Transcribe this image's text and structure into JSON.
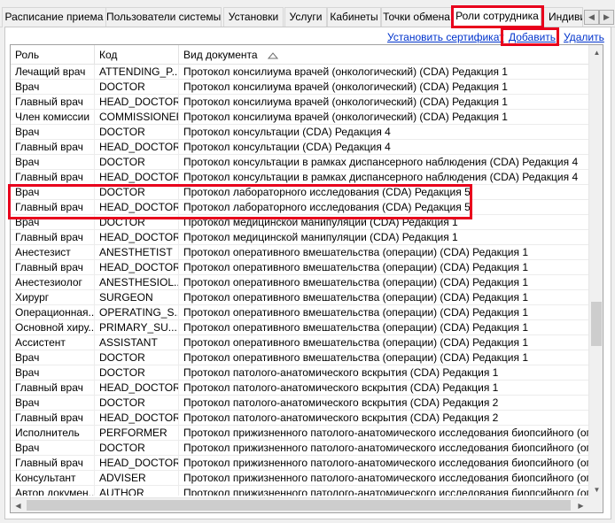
{
  "tabs": [
    {
      "label": "Расписание приема"
    },
    {
      "label": "Пользователи системы"
    },
    {
      "label": "Установки"
    },
    {
      "label": "Услуги"
    },
    {
      "label": "Кабинеты"
    },
    {
      "label": "Точки обмена"
    },
    {
      "label": "Роли сотрудника"
    },
    {
      "label": "Индивид"
    }
  ],
  "actions": {
    "install_cert": "Установить сертификат",
    "add": "Добавить",
    "delete": "Удалить"
  },
  "table": {
    "columns": [
      "Роль",
      "Код",
      "Вид документа"
    ],
    "sorted_column": "Вид документа",
    "sort_direction": "ascending",
    "rows": [
      [
        "Лечащий врач",
        "ATTENDING_P...",
        "Протокол консилиума врачей (онкологический) (CDA) Редакция 1"
      ],
      [
        "Врач",
        "DOCTOR",
        "Протокол консилиума врачей (онкологический) (CDA) Редакция 1"
      ],
      [
        "Главный врач",
        "HEAD_DOCTOR",
        "Протокол консилиума врачей (онкологический) (CDA) Редакция 1"
      ],
      [
        "Член комиссии",
        "COMMISSIONER",
        "Протокол консилиума врачей (онкологический) (CDA) Редакция 1"
      ],
      [
        "Врач",
        "DOCTOR",
        "Протокол консультации (CDA) Редакция 4"
      ],
      [
        "Главный врач",
        "HEAD_DOCTOR",
        "Протокол консультации (CDA) Редакция 4"
      ],
      [
        "Врач",
        "DOCTOR",
        "Протокол консультации в рамках диспансерного наблюдения (CDA) Редакция 4"
      ],
      [
        "Главный врач",
        "HEAD_DOCTOR",
        "Протокол консультации в рамках диспансерного наблюдения (CDA) Редакция 4"
      ],
      [
        "Врач",
        "DOCTOR",
        "Протокол лабораторного исследования (CDA) Редакция 5"
      ],
      [
        "Главный врач",
        "HEAD_DOCTOR",
        "Протокол лабораторного исследования (CDA) Редакция 5"
      ],
      [
        "Врач",
        "DOCTOR",
        "Протокол медицинской манипуляции (CDA) Редакция 1"
      ],
      [
        "Главный врач",
        "HEAD_DOCTOR",
        "Протокол медицинской манипуляции (CDA) Редакция 1"
      ],
      [
        "Анестезист",
        "ANESTHETIST",
        "Протокол оперативного вмешательства (операции) (CDA) Редакция 1"
      ],
      [
        "Главный врач",
        "HEAD_DOCTOR",
        "Протокол оперативного вмешательства (операции) (CDA) Редакция 1"
      ],
      [
        "Анестезиолог",
        "ANESTHESIOL...",
        "Протокол оперативного вмешательства (операции) (CDA) Редакция 1"
      ],
      [
        "Хирург",
        "SURGEON",
        "Протокол оперативного вмешательства (операции) (CDA) Редакция 1"
      ],
      [
        "Операционная...",
        "OPERATING_S...",
        "Протокол оперативного вмешательства (операции) (CDA) Редакция 1"
      ],
      [
        "Основной хиру...",
        "PRIMARY_SU...",
        "Протокол оперативного вмешательства (операции) (CDA) Редакция 1"
      ],
      [
        "Ассистент",
        "ASSISTANT",
        "Протокол оперативного вмешательства (операции) (CDA) Редакция 1"
      ],
      [
        "Врач",
        "DOCTOR",
        "Протокол оперативного вмешательства (операции) (CDA) Редакция 1"
      ],
      [
        "Врач",
        "DOCTOR",
        "Протокол патолого-анатомического вскрытия (CDA) Редакция 1"
      ],
      [
        "Главный врач",
        "HEAD_DOCTOR",
        "Протокол патолого-анатомического вскрытия (CDA) Редакция 1"
      ],
      [
        "Врач",
        "DOCTOR",
        "Протокол патолого-анатомического вскрытия (CDA) Редакция 2"
      ],
      [
        "Главный врач",
        "HEAD_DOCTOR",
        "Протокол патолого-анатомического вскрытия (CDA) Редакция 2"
      ],
      [
        "Исполнитель",
        "PERFORMER",
        "Протокол прижизненного патолого-анатомического исследования биопсийного (операц"
      ],
      [
        "Врач",
        "DOCTOR",
        "Протокол прижизненного патолого-анатомического исследования биопсийного (операц"
      ],
      [
        "Главный врач",
        "HEAD_DOCTOR",
        "Протокол прижизненного патолого-анатомического исследования биопсийного (операц"
      ],
      [
        "Консультант",
        "ADVISER",
        "Протокол прижизненного патолого-анатомического исследования биопсийного (операц"
      ],
      [
        "Автор докумен...",
        "AUTHOR",
        "Протокол прижизненного патолого-анатомического исследования биопсийного (операц"
      ]
    ]
  },
  "icons": {
    "sort": "triangle-up-icon",
    "tab_scroll_left": "chevron-left-icon",
    "tab_scroll_right": "chevron-right-icon"
  },
  "colors": {
    "highlight": "#e8001c",
    "link": "#0033cc"
  }
}
